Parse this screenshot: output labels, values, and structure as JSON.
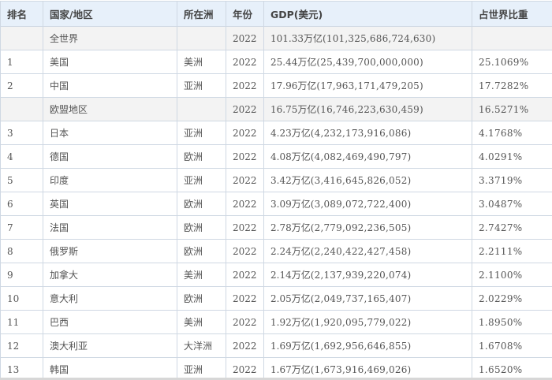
{
  "table": {
    "headers": {
      "rank": "排名",
      "country": "国家/地区",
      "continent": "所在洲",
      "year": "年份",
      "gdp": "GDP(美元)",
      "share": "占世界比重"
    },
    "rows": [
      {
        "rank": "",
        "country": "全世界",
        "continent": "",
        "year": "2022",
        "gdp_short": "101.33万亿",
        "gdp_full": "(101,325,686,724,630)",
        "share": "",
        "aggregate": true
      },
      {
        "rank": "1",
        "country": "美国",
        "continent": "美洲",
        "year": "2022",
        "gdp_short": "25.44万亿",
        "gdp_full": "(25,439,700,000,000)",
        "share": "25.1069%"
      },
      {
        "rank": "2",
        "country": "中国",
        "continent": "亚洲",
        "year": "2022",
        "gdp_short": "17.96万亿",
        "gdp_full": "(17,963,171,479,205)",
        "share": "17.7282%"
      },
      {
        "rank": "",
        "country": "欧盟地区",
        "continent": "",
        "year": "2022",
        "gdp_short": "16.75万亿",
        "gdp_full": "(16,746,223,630,459)",
        "share": "16.5271%",
        "aggregate": true
      },
      {
        "rank": "3",
        "country": "日本",
        "continent": "亚洲",
        "year": "2022",
        "gdp_short": "4.23万亿",
        "gdp_full": "(4,232,173,916,086)",
        "share": "4.1768%"
      },
      {
        "rank": "4",
        "country": "德国",
        "continent": "欧洲",
        "year": "2022",
        "gdp_short": "4.08万亿",
        "gdp_full": "(4,082,469,490,797)",
        "share": "4.0291%"
      },
      {
        "rank": "5",
        "country": "印度",
        "continent": "亚洲",
        "year": "2022",
        "gdp_short": "3.42万亿",
        "gdp_full": "(3,416,645,826,052)",
        "share": "3.3719%"
      },
      {
        "rank": "6",
        "country": "英国",
        "continent": "欧洲",
        "year": "2022",
        "gdp_short": "3.09万亿",
        "gdp_full": "(3,089,072,722,400)",
        "share": "3.0487%"
      },
      {
        "rank": "7",
        "country": "法国",
        "continent": "欧洲",
        "year": "2022",
        "gdp_short": "2.78万亿",
        "gdp_full": "(2,779,092,236,505)",
        "share": "2.7427%"
      },
      {
        "rank": "8",
        "country": "俄罗斯",
        "continent": "欧洲",
        "year": "2022",
        "gdp_short": "2.24万亿",
        "gdp_full": "(2,240,422,427,458)",
        "share": "2.2111%"
      },
      {
        "rank": "9",
        "country": "加拿大",
        "continent": "美洲",
        "year": "2022",
        "gdp_short": "2.14万亿",
        "gdp_full": "(2,137,939,220,074)",
        "share": "2.1100%"
      },
      {
        "rank": "10",
        "country": "意大利",
        "continent": "欧洲",
        "year": "2022",
        "gdp_short": "2.05万亿",
        "gdp_full": "(2,049,737,165,407)",
        "share": "2.0229%"
      },
      {
        "rank": "11",
        "country": "巴西",
        "continent": "美洲",
        "year": "2022",
        "gdp_short": "1.92万亿",
        "gdp_full": "(1,920,095,779,022)",
        "share": "1.8950%"
      },
      {
        "rank": "12",
        "country": "澳大利亚",
        "continent": "大洋洲",
        "year": "2022",
        "gdp_short": "1.69万亿",
        "gdp_full": "(1,692,956,646,855)",
        "share": "1.6708%"
      },
      {
        "rank": "13",
        "country": "韩国",
        "continent": "亚洲",
        "year": "2022",
        "gdp_short": "1.67万亿",
        "gdp_full": "(1,673,916,469,026)",
        "share": "1.6520%"
      }
    ]
  }
}
